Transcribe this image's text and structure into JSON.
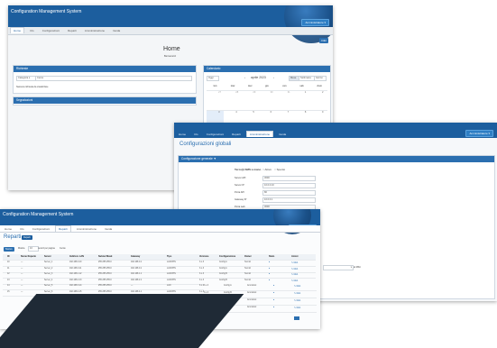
{
  "back_window": {
    "app_title": "Configuration Management System",
    "user_button": "Amministratore ▾",
    "nav": [
      "Home",
      "CIs",
      "Configurazioni",
      "Reparti",
      "Amministrazione",
      "Guida"
    ],
    "page_title": "Home",
    "page_subtitle": "Benvenuto!",
    "top_button": "Filtri",
    "panel_left_title": "Richieste",
    "panel_left_filter_select": "Categoria ▾",
    "panel_left_filter_input": "Cerca",
    "panel_left_empty": "Nessuna richiesta da visualizzare",
    "panel_left2_title": "Segnalazioni",
    "panel_right_title": "Calendario",
    "calendar_today": "Oggi",
    "calendar_month": "aprile 2023",
    "calendar_views": [
      "Mese",
      "Settimana",
      "Giorno"
    ],
    "calendar_days": [
      "lun",
      "mar",
      "mer",
      "gio",
      "ven",
      "sab",
      "dom"
    ],
    "calendar_weeks": [
      [
        "27",
        "28",
        "29",
        "30",
        "31",
        "1",
        "2"
      ],
      [
        "3",
        "4",
        "5",
        "6",
        "7",
        "8",
        "9"
      ],
      [
        "10",
        "11",
        "12",
        "13",
        "14",
        "15",
        "16"
      ],
      [
        "17",
        "18",
        "19",
        "20",
        "21",
        "22",
        "23"
      ]
    ]
  },
  "mid_window": {
    "nav": [
      "Home",
      "CIs",
      "Configurazioni",
      "Reparti",
      "Amministrazione",
      "Guida"
    ],
    "user_button": "Amministratore ▾",
    "page_title": "Configurazioni globali",
    "section_title": "Configurazione generale ▼",
    "radio_label": "Terzo(i) SMS a mano",
    "radio_options": [
      "Attivo",
      "Spento"
    ],
    "fields": [
      {
        "label": "Server API",
        "value": "3000"
      },
      {
        "label": "Server IP",
        "value": "10.0.0.10"
      },
      {
        "label": "Porta API",
        "value": "80"
      },
      {
        "label": "Gateway IP",
        "value": "10.0.0.1"
      },
      {
        "label": "Porta web",
        "value": "3000"
      }
    ]
  },
  "front_window": {
    "app_title": "Configuration Management System",
    "user_button": "Amministratore ▾",
    "nav": [
      "Home",
      "CIs",
      "Configurazioni",
      "Reparti",
      "Amministrazione",
      "Guida"
    ],
    "page_title": "Reparti",
    "badge": "Reparti",
    "toolbar_button": "Nuovo",
    "show_label": "Mostra",
    "show_value": "10",
    "records_label": "record per pagina",
    "search_label": "Cerca:",
    "columns": [
      "ID",
      "Nome Reparto",
      "Server",
      "Indirizzo LAN",
      "Subnet Mask",
      "Gateway",
      "Tipo",
      "Versione",
      "Configurazione",
      "Owner",
      "Stato",
      "Azioni"
    ],
    "rows": [
      [
        "10",
        "—",
        "Server_1",
        "192.168.0.10",
        "255.255.255.0",
        "192.168.0.1",
        "LAN/VPN",
        "3.x.3",
        "Config A",
        "Tecnici",
        "●",
        "✎ Mod."
      ],
      [
        "11",
        "—",
        "Server_2",
        "192.168.0.11",
        "255.255.255.0",
        "192.168.0.1",
        "LAN/VPN",
        "3.x.3",
        "Config A",
        "Tecnici",
        "●",
        "✎ Mod."
      ],
      [
        "12",
        "—",
        "Server_3",
        "192.168.1.12",
        "255.255.255.0",
        "192.168.1.1",
        "LAN/VPN",
        "3.x.3",
        "Config B",
        "Tecnici",
        "●",
        "✎ Mod."
      ],
      [
        "13",
        "—",
        "Server_4",
        "192.168.2.13",
        "255.255.255.0",
        "192.168.2.1",
        "LAN/VPN",
        "3.x.3",
        "Config B",
        "Tecnici",
        "●",
        "✎ Mod."
      ],
      [
        "14",
        "—",
        "Server_5",
        "192.168.3.14",
        "255.255.255.0",
        "—",
        "LAN",
        "3.x.2",
        "Config C",
        "Amministr.",
        "●",
        "✎ Mod."
      ],
      [
        "15",
        "—",
        "Server_6",
        "192.168.4.15",
        "255.255.255.0",
        "192.168.4.1",
        "LAN/VPN",
        "3.x.3",
        "Config C",
        "Amministr.",
        "●",
        "✎ Mod."
      ]
    ],
    "extra_rows": [
      [
        "3.x.3",
        "Config A",
        "Amministr.",
        "●",
        "✎ Mod."
      ],
      [
        "3.x.3",
        "Config B",
        "Amministr.",
        "●",
        "✎ Mod."
      ],
      [
        "3.x.2",
        "Config C",
        "Amministr.",
        "●",
        "✎ Mod."
      ],
      [
        "3.x.3",
        "Config D",
        "Amministr.",
        "●",
        "✎ Mod."
      ]
    ],
    "select_value": "▾",
    "select_suffix": "al Mbit"
  },
  "colors": {
    "header_blue": "#1c5e9e",
    "panel_blue": "#2b6fb0",
    "accent_dark": "#1f2a36"
  }
}
